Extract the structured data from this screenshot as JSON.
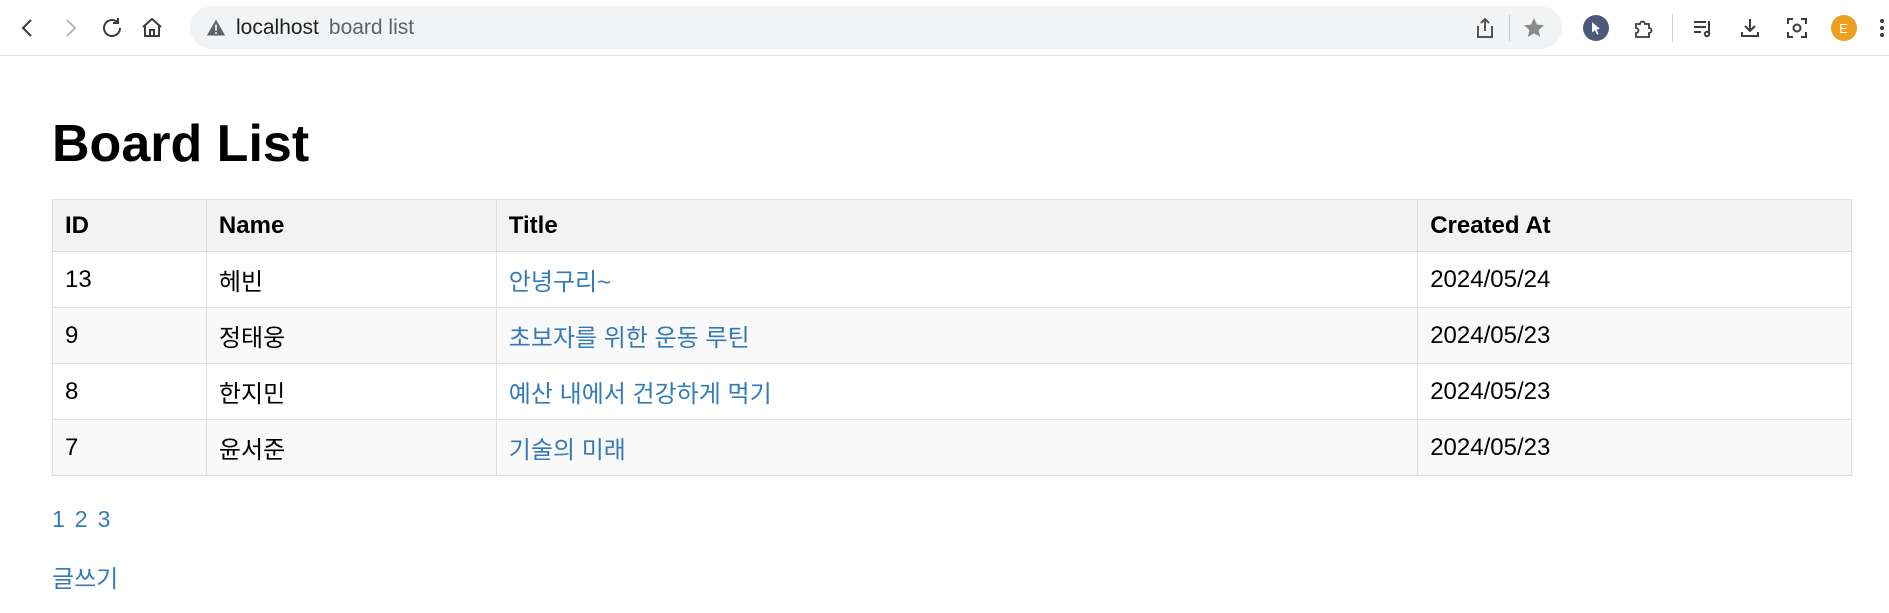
{
  "browser": {
    "url_host": "localhost",
    "url_path": "board list",
    "avatar_letter": "E"
  },
  "page": {
    "title": "Board List",
    "columns": [
      "ID",
      "Name",
      "Title",
      "Created At"
    ],
    "rows": [
      {
        "id": "13",
        "name": "헤빈",
        "title": "안녕구리~",
        "created_at": "2024/05/24"
      },
      {
        "id": "9",
        "name": "정태웅",
        "title": "초보자를 위한 운동 루틴",
        "created_at": "2024/05/23"
      },
      {
        "id": "8",
        "name": "한지민",
        "title": "예산 내에서 건강하게 먹기",
        "created_at": "2024/05/23"
      },
      {
        "id": "7",
        "name": "윤서준",
        "title": "기술의 미래",
        "created_at": "2024/05/23"
      }
    ],
    "pagination": [
      "1",
      "2",
      "3"
    ],
    "write_link": "글쓰기"
  },
  "colors": {
    "link": "#337ab7",
    "header_bg": "#f2f2f2",
    "border": "#dddddd"
  }
}
